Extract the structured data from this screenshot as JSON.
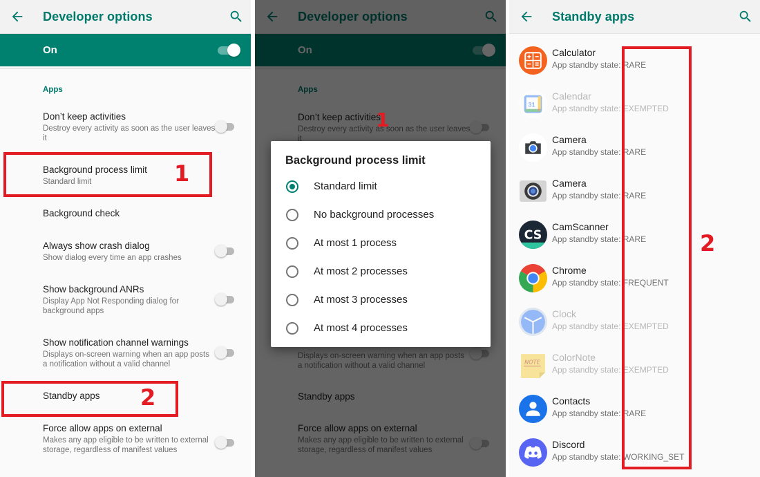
{
  "left_panel": {
    "appbar": {
      "title": "Developer options"
    },
    "master_switch": {
      "label": "On",
      "checked": true
    },
    "section_header": "Apps",
    "prefs": [
      {
        "title": "Don’t keep activities",
        "summary": "Destroy every activity as soon as the user leaves it",
        "toggle": false
      },
      {
        "title": "Background process limit",
        "summary": "Standard limit"
      },
      {
        "title": "Background check",
        "summary": ""
      },
      {
        "title": "Always show crash dialog",
        "summary": "Show dialog every time an app crashes",
        "toggle": false
      },
      {
        "title": "Show background ANRs",
        "summary": "Display App Not Responding dialog for background apps",
        "toggle": false
      },
      {
        "title": "Show notification channel warnings",
        "summary": "Displays on-screen warning when an app posts a notification without a valid channel",
        "toggle": false
      },
      {
        "title": "Standby apps",
        "summary": ""
      },
      {
        "title": "Force allow apps on external",
        "summary": "Makes any app eligible to be written to external storage, regardless of manifest values",
        "toggle": false
      }
    ],
    "annotations": {
      "step1": "1",
      "step2": "2"
    }
  },
  "mid_panel": {
    "appbar": {
      "title": "Developer options"
    },
    "master_switch": {
      "label": "On"
    },
    "section_header": "Apps",
    "background_prefs": [
      {
        "title": "Don’t keep activities",
        "summary": "Destroy every activity as soon as the user leaves it"
      },
      {
        "summary": "Displays on-screen warning when an app posts a notification without a valid channel"
      },
      {
        "title": "Standby apps"
      },
      {
        "title": "Force allow apps on external",
        "summary": "Makes any app eligible to be written to external storage, regardless of manifest values"
      }
    ],
    "annotation": "1",
    "dialog": {
      "title": "Background process limit",
      "selected_index": 0,
      "options": [
        "Standard limit",
        "No background processes",
        "At most 1 process",
        "At most 2 processes",
        "At most 3 processes",
        "At most 4 processes"
      ]
    }
  },
  "right_panel": {
    "appbar": {
      "title": "Standby apps"
    },
    "state_prefix": "App standby state:",
    "apps": [
      {
        "name": "Calculator",
        "state": "RARE",
        "enabled": true,
        "icon": "calculator-icon"
      },
      {
        "name": "Calendar",
        "state": "EXEMPTED",
        "enabled": false,
        "icon": "calendar-icon"
      },
      {
        "name": "Camera",
        "state": "RARE",
        "enabled": true,
        "icon": "camera-icon"
      },
      {
        "name": "Camera",
        "state": "RARE",
        "enabled": true,
        "icon": "legacy-camera-icon"
      },
      {
        "name": "CamScanner",
        "state": "RARE",
        "enabled": true,
        "icon": "camscanner-icon"
      },
      {
        "name": "Chrome",
        "state": "FREQUENT",
        "enabled": true,
        "icon": "chrome-icon"
      },
      {
        "name": "Clock",
        "state": "EXEMPTED",
        "enabled": false,
        "icon": "clock-icon"
      },
      {
        "name": "ColorNote",
        "state": "EXEMPTED",
        "enabled": false,
        "icon": "colornote-icon"
      },
      {
        "name": "Contacts",
        "state": "RARE",
        "enabled": true,
        "icon": "contacts-icon"
      },
      {
        "name": "Discord",
        "state": "WORKING_SET",
        "enabled": true,
        "icon": "discord-icon"
      }
    ],
    "calendar_icon_day": "31",
    "camscanner_icon_text": "CS",
    "colornote_icon_text": "NOTE",
    "annotation": "2"
  },
  "colors": {
    "accent": "#00796b",
    "master_bar": "#00806f",
    "annotation_red": "#e31b23"
  }
}
